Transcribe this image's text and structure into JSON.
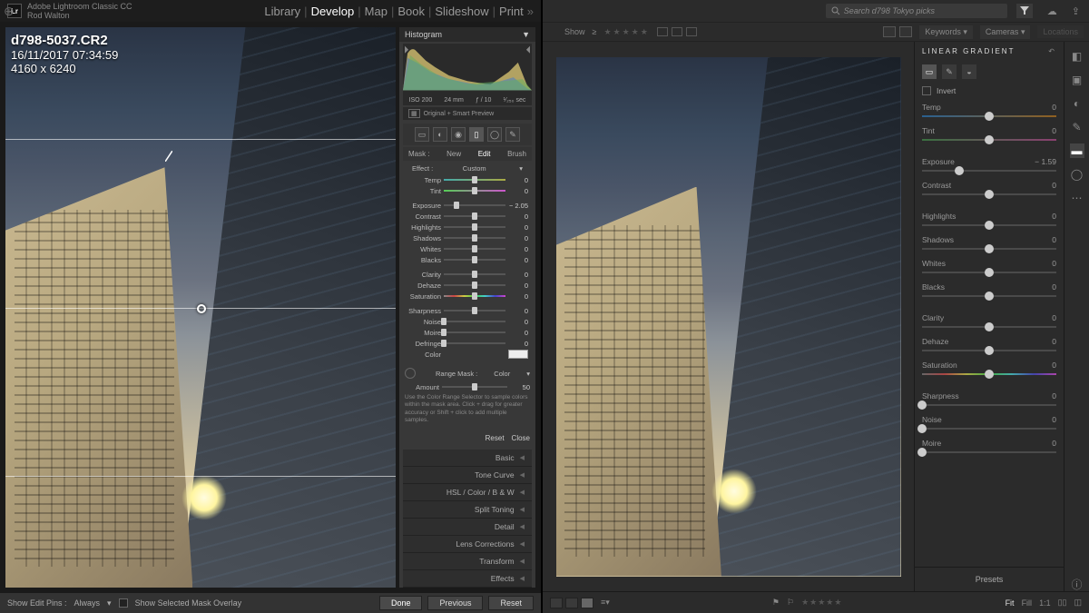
{
  "classic": {
    "app_name": "Adobe Lightroom Classic CC",
    "user": "Rod Walton",
    "modules": [
      "Library",
      "Develop",
      "Map",
      "Book",
      "Slideshow",
      "Print"
    ],
    "active_module": "Develop",
    "image_info": {
      "filename": "d798-5037.CR2",
      "datetime": "16/11/2017 07:34:59",
      "dimensions": "4160 x 6240"
    },
    "histogram_label": "Histogram",
    "histo_info": {
      "iso": "ISO 200",
      "focal": "24 mm",
      "aperture": "ƒ / 10",
      "shutter": "¹⁄₂₅₀ sec"
    },
    "histo_sub": "Original + Smart Preview",
    "mask_label": "Mask :",
    "mask_tabs": {
      "new": "New",
      "edit": "Edit",
      "brush": "Brush"
    },
    "effect_label": "Effect :",
    "effect_value": "Custom",
    "sliders": {
      "temp": {
        "label": "Temp",
        "val": "0",
        "pos": 50
      },
      "tint": {
        "label": "Tint",
        "val": "0",
        "pos": 50
      },
      "exposure": {
        "label": "Exposure",
        "val": "− 2.05",
        "pos": 20
      },
      "contrast": {
        "label": "Contrast",
        "val": "0",
        "pos": 50
      },
      "highlights": {
        "label": "Highlights",
        "val": "0",
        "pos": 50
      },
      "shadows": {
        "label": "Shadows",
        "val": "0",
        "pos": 50
      },
      "whites": {
        "label": "Whites",
        "val": "0",
        "pos": 50
      },
      "blacks": {
        "label": "Blacks",
        "val": "0",
        "pos": 50
      },
      "clarity": {
        "label": "Clarity",
        "val": "0",
        "pos": 50
      },
      "dehaze": {
        "label": "Dehaze",
        "val": "0",
        "pos": 50
      },
      "saturation": {
        "label": "Saturation",
        "val": "0",
        "pos": 50
      },
      "sharpness": {
        "label": "Sharpness",
        "val": "0",
        "pos": 50
      },
      "noise": {
        "label": "Noise",
        "val": "0",
        "pos": 0
      },
      "moire": {
        "label": "Moire",
        "val": "0",
        "pos": 0
      },
      "defringe": {
        "label": "Defringe",
        "val": "0",
        "pos": 0
      }
    },
    "color_label": "Color",
    "range_mask": {
      "label": "Range Mask :",
      "type": "Color",
      "amount_label": "Amount",
      "amount_val": "50",
      "help": "Use the Color Range Selector to sample colors within the mask area. Click + drag for greater accuracy or Shift + click to add multiple samples."
    },
    "reset": "Reset",
    "close": "Close",
    "collapsed": [
      "Basic",
      "Tone Curve",
      "HSL / Color / B & W",
      "Split Toning",
      "Detail",
      "Lens Corrections",
      "Transform",
      "Effects"
    ],
    "bottom": {
      "pins_label": "Show Edit Pins :",
      "pins_value": "Always",
      "overlay": "Show Selected Mask Overlay",
      "done": "Done",
      "previous": "Previous",
      "reset": "Reset"
    }
  },
  "cc": {
    "search_placeholder": "Search d798 Tokyo picks",
    "show_label": "Show",
    "dropdowns": {
      "keywords": "Keywords",
      "cameras": "Cameras",
      "locations": "Locations"
    },
    "panel_title": "LINEAR GRADIENT",
    "invert": "Invert",
    "sliders": {
      "temp": {
        "label": "Temp",
        "val": "0",
        "pos": 50
      },
      "tint": {
        "label": "Tint",
        "val": "0",
        "pos": 50
      },
      "exposure": {
        "label": "Exposure",
        "val": "− 1.59",
        "pos": 28
      },
      "contrast": {
        "label": "Contrast",
        "val": "0",
        "pos": 50
      },
      "highlights": {
        "label": "Highlights",
        "val": "0",
        "pos": 50
      },
      "shadows": {
        "label": "Shadows",
        "val": "0",
        "pos": 50
      },
      "whites": {
        "label": "Whites",
        "val": "0",
        "pos": 50
      },
      "blacks": {
        "label": "Blacks",
        "val": "0",
        "pos": 50
      },
      "clarity": {
        "label": "Clarity",
        "val": "0",
        "pos": 50
      },
      "dehaze": {
        "label": "Dehaze",
        "val": "0",
        "pos": 50
      },
      "saturation": {
        "label": "Saturation",
        "val": "0",
        "pos": 50
      },
      "sharpness": {
        "label": "Sharpness",
        "val": "0",
        "pos": 0
      },
      "noise": {
        "label": "Noise",
        "val": "0",
        "pos": 0
      },
      "moire": {
        "label": "Moire",
        "val": "0",
        "pos": 0
      }
    },
    "presets": "Presets",
    "bottom": {
      "fit": "Fit",
      "fill": "Fill",
      "one": "1:1"
    }
  }
}
